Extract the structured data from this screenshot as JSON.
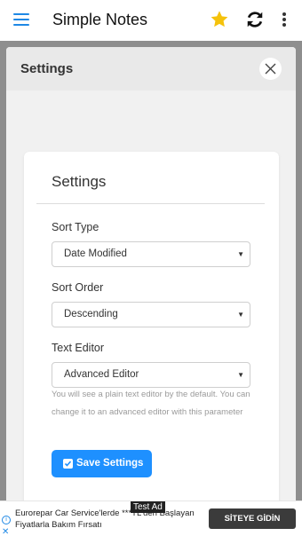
{
  "app_bar": {
    "title": "Simple Notes",
    "icons": [
      "menu-icon",
      "star-icon",
      "sync-icon",
      "more-vertical-icon"
    ],
    "star_color": "#f5c20b",
    "menu_color": "#1e88e5"
  },
  "modal": {
    "title": "Settings",
    "close_icon": "close-icon"
  },
  "card": {
    "title": "Settings",
    "sort_type": {
      "label": "Sort Type",
      "value": "Date Modified"
    },
    "sort_order": {
      "label": "Sort Order",
      "value": "Descending"
    },
    "text_editor": {
      "label": "Text Editor",
      "value": "Advanced Editor",
      "help": "You will see a plain text editor by the default. You can change it to an advanced editor with this parameter"
    },
    "save_button": {
      "label": "Save Settings",
      "icon": "checkbox-icon",
      "color": "#1e90ff"
    }
  },
  "ad": {
    "test_label": "Test Ad",
    "text": "Eurorepar Car Service'lerde ***TL'den Başlayan Fiyatlarla Bakım Fırsatı",
    "cta": "SİTEYE GİDİN"
  }
}
